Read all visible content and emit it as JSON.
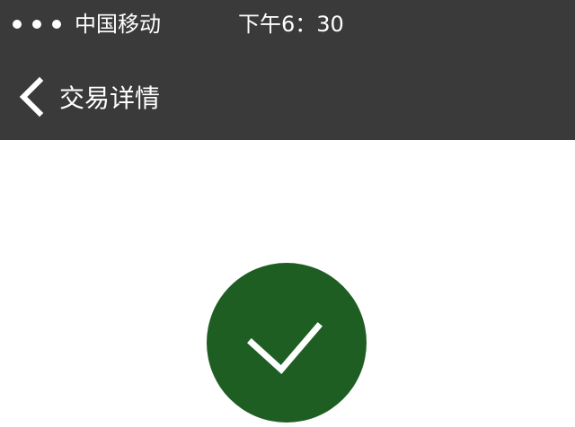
{
  "status_bar": {
    "carrier": "中国移动",
    "time": "下午6：30",
    "signal_icon": "signal-dots-icon"
  },
  "nav_bar": {
    "title": "交易详情",
    "back_icon": "chevron-left-icon"
  },
  "result": {
    "status_icon": "checkmark-icon",
    "badge_color": "#1e5e22"
  },
  "theme": {
    "header_background": "#3a3a3a",
    "text_color": "#ffffff",
    "page_background": "#ffffff"
  }
}
